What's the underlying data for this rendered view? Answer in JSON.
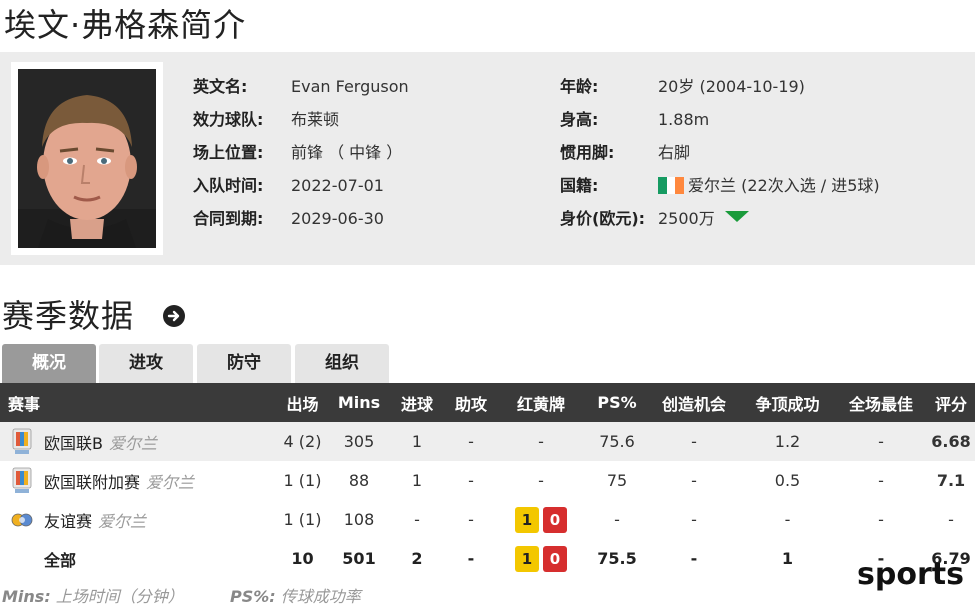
{
  "page": {
    "title": "埃文·弗格森简介",
    "watermark": "sports"
  },
  "profile": {
    "left": [
      {
        "label": "英文名:",
        "value": "Evan Ferguson"
      },
      {
        "label": "效力球队:",
        "value": "布莱顿"
      },
      {
        "label": "场上位置:",
        "value": "前锋 （ 中锋 ）"
      },
      {
        "label": "入队时间:",
        "value": "2022-07-01"
      },
      {
        "label": "合同到期:",
        "value": "2029-06-30"
      }
    ],
    "right": [
      {
        "label": "年龄:",
        "value": "20岁  (2004-10-19)"
      },
      {
        "label": "身高:",
        "value": "1.88m"
      },
      {
        "label": "惯用脚:",
        "value": "右脚"
      },
      {
        "label": "国籍:",
        "value": "爱尔兰 (22次入选 / 进5球)"
      },
      {
        "label": "身价(欧元):",
        "value": "2500万"
      }
    ],
    "flag_colors": [
      "#169b62",
      "#ffffff",
      "#ff883e"
    ],
    "value_trend": "down",
    "value_trend_color": "#1a9b3b"
  },
  "season": {
    "title": "赛季数据",
    "tabs": [
      "概况",
      "进攻",
      "防守",
      "组织"
    ],
    "active_tab": 0,
    "headers": [
      "赛事",
      "出场",
      "Mins",
      "进球",
      "助攻",
      "红黄牌",
      "PS%",
      "创造机会",
      "争顶成功",
      "全场最佳",
      "评分"
    ],
    "rows": [
      {
        "competition": "欧国联B",
        "country": "爱尔兰",
        "icon": "nations-league-icon",
        "apps": "4 (2)",
        "mins": "305",
        "goals": "1",
        "assists": "-",
        "cards": "-",
        "yellow": "",
        "red": "",
        "ps": "75.6",
        "chances": "-",
        "aerials": "1.2",
        "motm": "-",
        "rating": "6.68"
      },
      {
        "competition": "欧国联附加赛",
        "country": "爱尔兰",
        "icon": "nations-league-icon",
        "apps": "1 (1)",
        "mins": "88",
        "goals": "1",
        "assists": "-",
        "cards": "-",
        "yellow": "",
        "red": "",
        "ps": "75",
        "chances": "-",
        "aerials": "0.5",
        "motm": "-",
        "rating": "7.1"
      },
      {
        "competition": "友谊赛",
        "country": "爱尔兰",
        "icon": "friendly-icon",
        "apps": "1 (1)",
        "mins": "108",
        "goals": "-",
        "assists": "-",
        "cards": "",
        "yellow": "1",
        "red": "0",
        "ps": "-",
        "chances": "-",
        "aerials": "-",
        "motm": "-",
        "rating": "-"
      }
    ],
    "total": {
      "label": "全部",
      "apps": "10",
      "mins": "501",
      "goals": "2",
      "assists": "-",
      "yellow": "1",
      "red": "0",
      "ps": "75.5",
      "chances": "-",
      "aerials": "1",
      "motm": "-",
      "rating": "6.79"
    }
  },
  "footnotes": [
    {
      "key": "Mins:",
      "text": " 上场时间（分钟）"
    },
    {
      "key": "PS%:",
      "text": " 传球成功率"
    }
  ]
}
